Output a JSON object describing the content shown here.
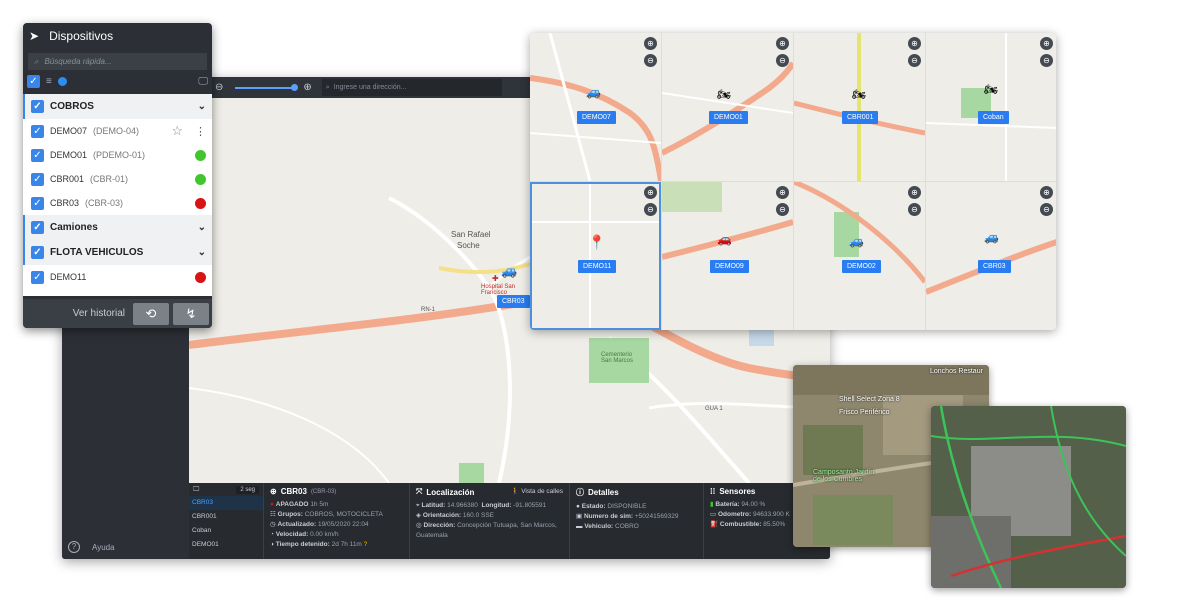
{
  "devices_panel": {
    "title": "Dispositivos",
    "search_placeholder": "Búsqueda rápida...",
    "groups": [
      {
        "name": "COBROS",
        "items": [
          {
            "name": "DEMO07",
            "alias": "(DEMO-04)",
            "status": "star"
          },
          {
            "name": "DEMO01",
            "alias": "(PDEMO-01)",
            "status": "#43c530"
          },
          {
            "name": "CBR001",
            "alias": "(CBR-01)",
            "status": "#43c530"
          },
          {
            "name": "CBR03",
            "alias": "(CBR-03)",
            "status": "#d61414"
          }
        ]
      },
      {
        "name": "Camiones",
        "items": []
      },
      {
        "name": "FLOTA VEHICULOS",
        "items": [
          {
            "name": "DEMO11",
            "alias": "",
            "status": "#d61414"
          }
        ]
      }
    ],
    "footer_label": "Ver historial"
  },
  "toolbar": {
    "address_placeholder": "Ingrese una dirección..."
  },
  "map_labels": {
    "san_rafael": "San Rafael",
    "soche": "Soche",
    "hospital": "Hospital San Francisco",
    "vehicle": "CBR03",
    "rn1": "RN-1",
    "cementerio": "Cementerio San Marcos",
    "gua1": "GUA 1"
  },
  "bottom_bar": {
    "interval": "2 seg",
    "devices": [
      "CBR03",
      "CBR001",
      "Coban",
      "DEMO01"
    ],
    "active_device": "CBR03",
    "device": {
      "name": "CBR03",
      "alias": "(CBR-03)",
      "state": "APAGADO",
      "state_duration": "1h 5m",
      "rows": [
        {
          "k": "Grupos:",
          "v": "COBROS, MOTOCICLETA"
        },
        {
          "k": "Actualizado:",
          "v": "19/05/2020 22:04"
        },
        {
          "k": "Velocidad:",
          "v": "0.00 km/h"
        },
        {
          "k": "Tiempo detenido:",
          "v": "2d 7h 11m"
        }
      ]
    },
    "location": {
      "title": "Localización",
      "street_view": "Vista de calles",
      "latitude_k": "Latitud:",
      "latitude": "14.966380",
      "longitude_k": "Longitud:",
      "longitude": "-91.805591",
      "orientation_k": "Orientación:",
      "orientation": "160.0 SSE",
      "address_k": "Dirección:",
      "address": "Concepción Tutuapa, San Marcos, Guatemala"
    },
    "details": {
      "title": "Detalles",
      "rows": [
        {
          "k": "Estado:",
          "v": "DISPONIBLE"
        },
        {
          "k": "Numero de sim:",
          "v": "+50241569329"
        },
        {
          "k": "Vehiculo:",
          "v": "COBRO"
        }
      ]
    },
    "sensors": {
      "title": "Sensores",
      "rows": [
        {
          "k": "Batería:",
          "v": "94.00 %"
        },
        {
          "k": "Odometro:",
          "v": "94633.900 K"
        },
        {
          "k": "Combustible:",
          "v": "85.50%"
        }
      ]
    }
  },
  "help_label": "Ayuda",
  "grid_tiles": [
    {
      "label": "DEMO07"
    },
    {
      "label": "DEMO01"
    },
    {
      "label": "CBR001"
    },
    {
      "label": "Coban"
    },
    {
      "label": "DEMO11"
    },
    {
      "label": "DEMO09"
    },
    {
      "label": "DEMO02"
    },
    {
      "label": "CBR03"
    }
  ],
  "satellite1": {
    "labels": [
      "Lonchos Restaur",
      "Shell Select Zona 8",
      "Frisco Periférico",
      "Camposanto Jardín de los Cumbres"
    ]
  }
}
